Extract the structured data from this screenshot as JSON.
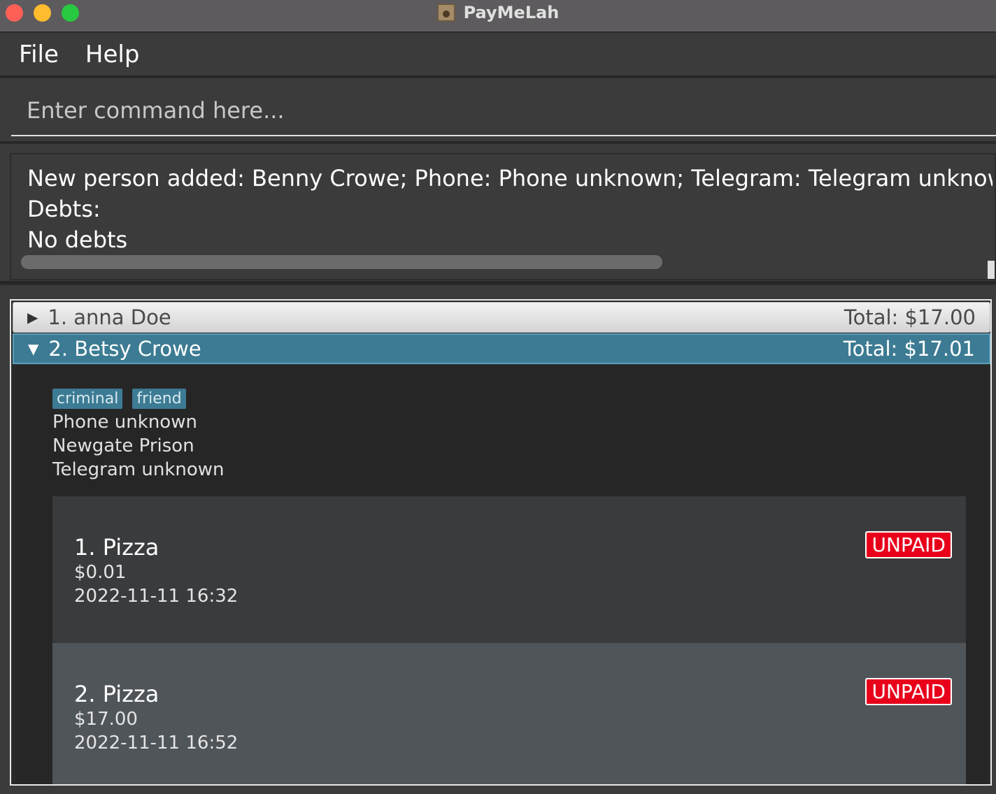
{
  "window": {
    "title": "PayMeLah",
    "colors": {
      "titlebar": "#5d5b5d",
      "close": "#fe5f57",
      "minimize": "#febc2e",
      "maximize": "#28c840"
    }
  },
  "menu": {
    "items": [
      {
        "label": "File"
      },
      {
        "label": "Help"
      }
    ]
  },
  "command": {
    "placeholder": "Enter command here...",
    "value": ""
  },
  "result": {
    "lines": [
      "New person added: Benny Crowe; Phone: Phone unknown; Telegram: Telegram unknown; Address:",
      "Debts:",
      "No debts"
    ]
  },
  "persons": [
    {
      "header": "1. anna Doe",
      "total": "Total: $17.00",
      "expanded": false
    },
    {
      "header": "2. Betsy Crowe",
      "total": "Total: $17.01",
      "expanded": true,
      "tags": [
        "criminal",
        "friend"
      ],
      "phone": "Phone unknown",
      "address": "Newgate Prison",
      "telegram": "Telegram unknown",
      "debts": [
        {
          "title": "1.  Pizza",
          "amount": "$0.01",
          "datetime": "2022-11-11 16:32",
          "status": "UNPAID"
        },
        {
          "title": "2.  Pizza",
          "amount": "$17.00",
          "datetime": "2022-11-11 16:52",
          "status": "UNPAID"
        }
      ]
    }
  ],
  "accent_colors": {
    "selected_row": "#3c7b93",
    "unpaid": "#e8001b"
  }
}
